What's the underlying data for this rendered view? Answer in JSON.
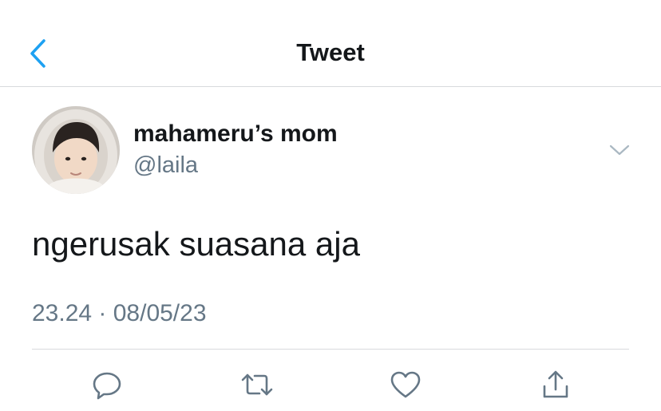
{
  "header": {
    "title": "Tweet",
    "back_icon": "chevron-left-icon"
  },
  "colors": {
    "accent": "#1da1f2",
    "text_primary": "#14171a",
    "text_secondary": "#657786",
    "divider": "#d8dadd"
  },
  "tweet": {
    "author": {
      "name": "mahameru’s mom",
      "handle": "@laila",
      "avatar_icon": "avatar-photo"
    },
    "more_icon": "chevron-down-icon",
    "text": "ngerusak suasana aja",
    "timestamp": "23.24 · 08/05/23"
  },
  "actions": [
    {
      "name": "reply",
      "icon": "reply-icon"
    },
    {
      "name": "retweet",
      "icon": "retweet-icon"
    },
    {
      "name": "like",
      "icon": "heart-icon"
    },
    {
      "name": "share",
      "icon": "share-icon"
    }
  ]
}
